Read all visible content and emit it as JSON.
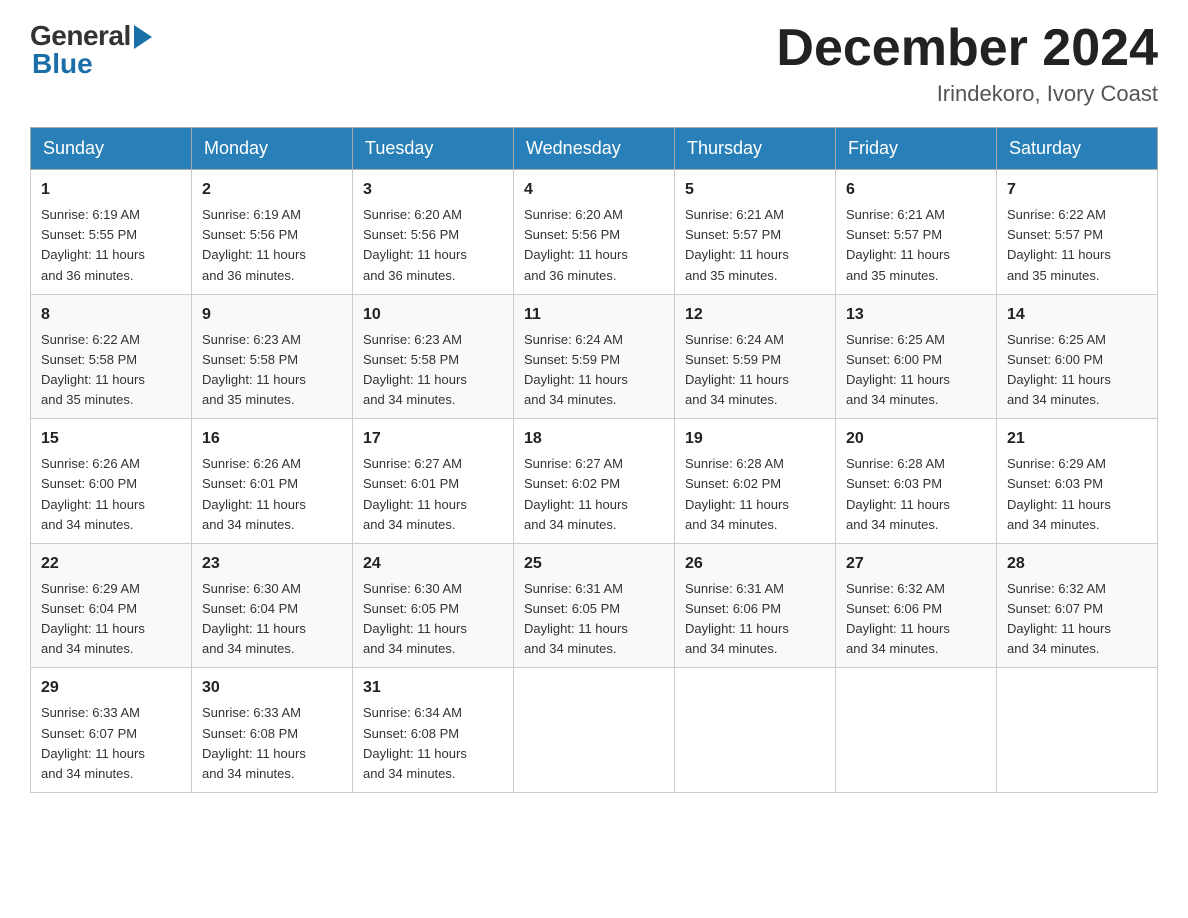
{
  "header": {
    "logo_general": "General",
    "logo_blue": "Blue",
    "month_title": "December 2024",
    "location": "Irindekoro, Ivory Coast"
  },
  "days_of_week": [
    "Sunday",
    "Monday",
    "Tuesday",
    "Wednesday",
    "Thursday",
    "Friday",
    "Saturday"
  ],
  "weeks": [
    [
      {
        "day": "1",
        "sunrise": "6:19 AM",
        "sunset": "5:55 PM",
        "daylight": "11 hours and 36 minutes."
      },
      {
        "day": "2",
        "sunrise": "6:19 AM",
        "sunset": "5:56 PM",
        "daylight": "11 hours and 36 minutes."
      },
      {
        "day": "3",
        "sunrise": "6:20 AM",
        "sunset": "5:56 PM",
        "daylight": "11 hours and 36 minutes."
      },
      {
        "day": "4",
        "sunrise": "6:20 AM",
        "sunset": "5:56 PM",
        "daylight": "11 hours and 36 minutes."
      },
      {
        "day": "5",
        "sunrise": "6:21 AM",
        "sunset": "5:57 PM",
        "daylight": "11 hours and 35 minutes."
      },
      {
        "day": "6",
        "sunrise": "6:21 AM",
        "sunset": "5:57 PM",
        "daylight": "11 hours and 35 minutes."
      },
      {
        "day": "7",
        "sunrise": "6:22 AM",
        "sunset": "5:57 PM",
        "daylight": "11 hours and 35 minutes."
      }
    ],
    [
      {
        "day": "8",
        "sunrise": "6:22 AM",
        "sunset": "5:58 PM",
        "daylight": "11 hours and 35 minutes."
      },
      {
        "day": "9",
        "sunrise": "6:23 AM",
        "sunset": "5:58 PM",
        "daylight": "11 hours and 35 minutes."
      },
      {
        "day": "10",
        "sunrise": "6:23 AM",
        "sunset": "5:58 PM",
        "daylight": "11 hours and 34 minutes."
      },
      {
        "day": "11",
        "sunrise": "6:24 AM",
        "sunset": "5:59 PM",
        "daylight": "11 hours and 34 minutes."
      },
      {
        "day": "12",
        "sunrise": "6:24 AM",
        "sunset": "5:59 PM",
        "daylight": "11 hours and 34 minutes."
      },
      {
        "day": "13",
        "sunrise": "6:25 AM",
        "sunset": "6:00 PM",
        "daylight": "11 hours and 34 minutes."
      },
      {
        "day": "14",
        "sunrise": "6:25 AM",
        "sunset": "6:00 PM",
        "daylight": "11 hours and 34 minutes."
      }
    ],
    [
      {
        "day": "15",
        "sunrise": "6:26 AM",
        "sunset": "6:00 PM",
        "daylight": "11 hours and 34 minutes."
      },
      {
        "day": "16",
        "sunrise": "6:26 AM",
        "sunset": "6:01 PM",
        "daylight": "11 hours and 34 minutes."
      },
      {
        "day": "17",
        "sunrise": "6:27 AM",
        "sunset": "6:01 PM",
        "daylight": "11 hours and 34 minutes."
      },
      {
        "day": "18",
        "sunrise": "6:27 AM",
        "sunset": "6:02 PM",
        "daylight": "11 hours and 34 minutes."
      },
      {
        "day": "19",
        "sunrise": "6:28 AM",
        "sunset": "6:02 PM",
        "daylight": "11 hours and 34 minutes."
      },
      {
        "day": "20",
        "sunrise": "6:28 AM",
        "sunset": "6:03 PM",
        "daylight": "11 hours and 34 minutes."
      },
      {
        "day": "21",
        "sunrise": "6:29 AM",
        "sunset": "6:03 PM",
        "daylight": "11 hours and 34 minutes."
      }
    ],
    [
      {
        "day": "22",
        "sunrise": "6:29 AM",
        "sunset": "6:04 PM",
        "daylight": "11 hours and 34 minutes."
      },
      {
        "day": "23",
        "sunrise": "6:30 AM",
        "sunset": "6:04 PM",
        "daylight": "11 hours and 34 minutes."
      },
      {
        "day": "24",
        "sunrise": "6:30 AM",
        "sunset": "6:05 PM",
        "daylight": "11 hours and 34 minutes."
      },
      {
        "day": "25",
        "sunrise": "6:31 AM",
        "sunset": "6:05 PM",
        "daylight": "11 hours and 34 minutes."
      },
      {
        "day": "26",
        "sunrise": "6:31 AM",
        "sunset": "6:06 PM",
        "daylight": "11 hours and 34 minutes."
      },
      {
        "day": "27",
        "sunrise": "6:32 AM",
        "sunset": "6:06 PM",
        "daylight": "11 hours and 34 minutes."
      },
      {
        "day": "28",
        "sunrise": "6:32 AM",
        "sunset": "6:07 PM",
        "daylight": "11 hours and 34 minutes."
      }
    ],
    [
      {
        "day": "29",
        "sunrise": "6:33 AM",
        "sunset": "6:07 PM",
        "daylight": "11 hours and 34 minutes."
      },
      {
        "day": "30",
        "sunrise": "6:33 AM",
        "sunset": "6:08 PM",
        "daylight": "11 hours and 34 minutes."
      },
      {
        "day": "31",
        "sunrise": "6:34 AM",
        "sunset": "6:08 PM",
        "daylight": "11 hours and 34 minutes."
      },
      null,
      null,
      null,
      null
    ]
  ],
  "labels": {
    "sunrise": "Sunrise:",
    "sunset": "Sunset:",
    "daylight": "Daylight:"
  }
}
